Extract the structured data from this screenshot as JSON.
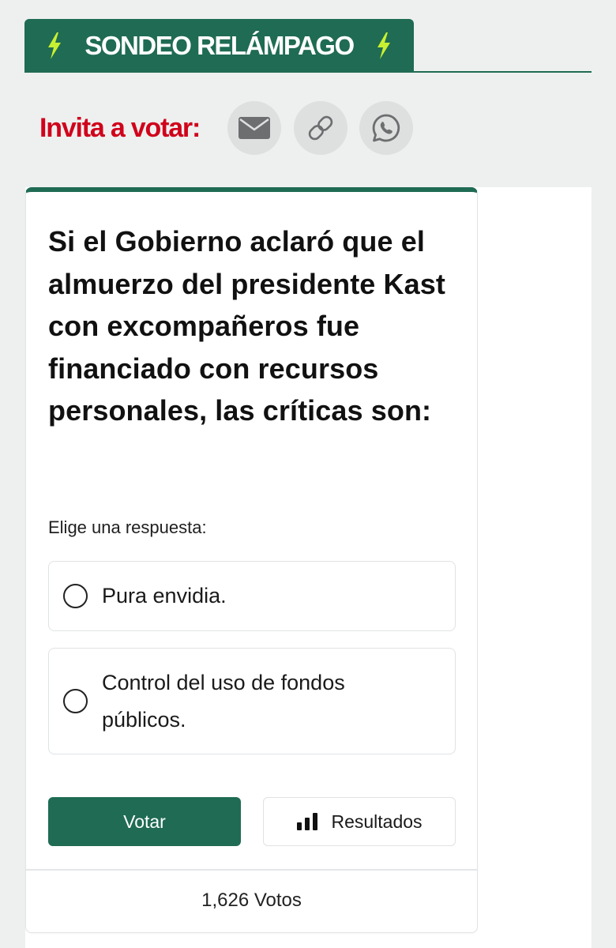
{
  "header": {
    "title": "SONDEO RELÁMPAGO",
    "icon": "lightning-bolt-icon",
    "bolt_color": "#c8f032"
  },
  "share": {
    "label": "Invita a votar:",
    "label_color": "#d0021b",
    "buttons": [
      {
        "name": "email",
        "icon": "envelope-icon"
      },
      {
        "name": "copy-link",
        "icon": "link-icon"
      },
      {
        "name": "whatsapp",
        "icon": "whatsapp-icon"
      }
    ]
  },
  "poll": {
    "question": "Si el Gobierno aclaró que el almuerzo del presidente Kast con excompañeros fue financiado con recursos personales, las críticas son:",
    "instruction": "Elige una respuesta:",
    "options": [
      {
        "label": "Pura envidia.",
        "selected": false
      },
      {
        "label": "Control del uso de fondos públicos.",
        "selected": false
      }
    ],
    "vote_button": "Votar",
    "results_button": "Resultados",
    "results_icon": "bar-chart-icon",
    "votes_label": "1,626 Votos"
  },
  "colors": {
    "accent": "#1f6b53",
    "background": "#edf0ef"
  }
}
